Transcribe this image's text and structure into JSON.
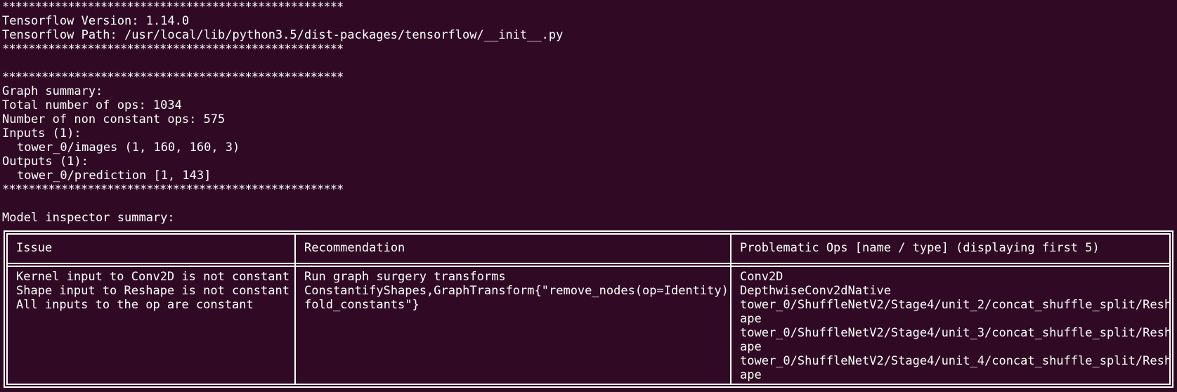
{
  "terminal": {
    "stars": "****************************************************",
    "version_line": "Tensorflow Version: 1.14.0",
    "path_line": "Tensorflow Path: /usr/local/lib/python3.5/dist-packages/tensorflow/__init__.py",
    "graph_summary": "Graph summary:",
    "total_ops": "Total number of ops: 1034",
    "non_constant_ops": "Number of non constant ops: 575",
    "inputs_header": "Inputs (1):",
    "input_item": "tower_0/images (1, 160, 160, 3)",
    "outputs_header": "Outputs (1):",
    "output_item": "tower_0/prediction [1, 143]",
    "inspector_summary": "Model inspector summary:"
  },
  "table": {
    "headers": [
      "Issue",
      "Recommendation",
      "Problematic Ops [name / type] (displaying first 5)"
    ],
    "issues": [
      "Kernel input to Conv2D is not constant",
      "Shape input to Reshape is not constant",
      "All inputs to the op are constant"
    ],
    "recommendations": [
      "Run graph surgery transforms",
      "ConstantifyShapes,GraphTransform{\"remove_nodes(op=Identity)",
      "fold_constants\"}"
    ],
    "ops": [
      "Conv2D",
      "DepthwiseConv2dNative",
      "tower_0/ShuffleNetV2/Stage4/unit_2/concat_shuffle_split/Resh",
      "ape",
      "tower_0/ShuffleNetV2/Stage4/unit_3/concat_shuffle_split/Resh",
      "ape",
      "tower_0/ShuffleNetV2/Stage4/unit_4/concat_shuffle_split/Resh",
      "ape"
    ]
  },
  "colors": {
    "background": "#300a24",
    "foreground": "#ffffff"
  }
}
